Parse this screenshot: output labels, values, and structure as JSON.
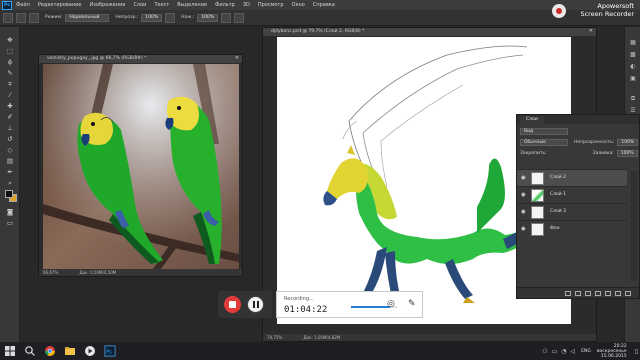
{
  "app": {
    "logo_text": "Ps",
    "menu": [
      "Файл",
      "Редактирование",
      "Изображение",
      "Слои",
      "Текст",
      "Выделение",
      "Фильтр",
      "3D",
      "Просмотр",
      "Окно",
      "Справка"
    ]
  },
  "options_bar": {
    "mode_label": "Режим:",
    "mode_value": "Нормальный",
    "opacity_label": "Непрозр.:",
    "opacity_value": "100%",
    "pressure_label": "Наж.:",
    "pressure_value": "100%"
  },
  "watermark": {
    "line1": "Apowersoft",
    "line2": "Screen Recorder"
  },
  "documents": [
    {
      "title": "volnistiy_popugay_.jpg @ 66,7% (RGB/8#) *",
      "zoom": "66,67%",
      "info": "Док: 0,50М/0,50М"
    },
    {
      "title": "djdybonc.psd @ 79,7% (Слой 2, RGB/8) *",
      "zoom": "79,75%",
      "info": "Док: 1,05М/4,82М"
    }
  ],
  "layers_panel": {
    "tab": "Слои",
    "kind_filter": "Вид",
    "blend_mode": "Обычные",
    "opacity_label": "Непрозрачность:",
    "opacity_value": "100%",
    "lock_label": "Закрепить:",
    "fill_label": "Заливка:",
    "fill_value": "100%",
    "layers": [
      {
        "name": "Слой 2",
        "active": true
      },
      {
        "name": "Слой 1",
        "active": false
      },
      {
        "name": "Слой 3",
        "active": false
      },
      {
        "name": "Фон",
        "active": false
      }
    ]
  },
  "recorder": {
    "status": "Recording...",
    "time": "01:04:22",
    "audio_level": 0.85
  },
  "taskbar": {
    "language": "ENG",
    "time": "20:22",
    "day": "воскресенье",
    "date": "15.06.2015"
  },
  "colors": {
    "foreground": "#0f0f0f",
    "background": "#d9a220",
    "recorder_stop": "#e13b3b",
    "accent_blue": "#31a8ff"
  }
}
